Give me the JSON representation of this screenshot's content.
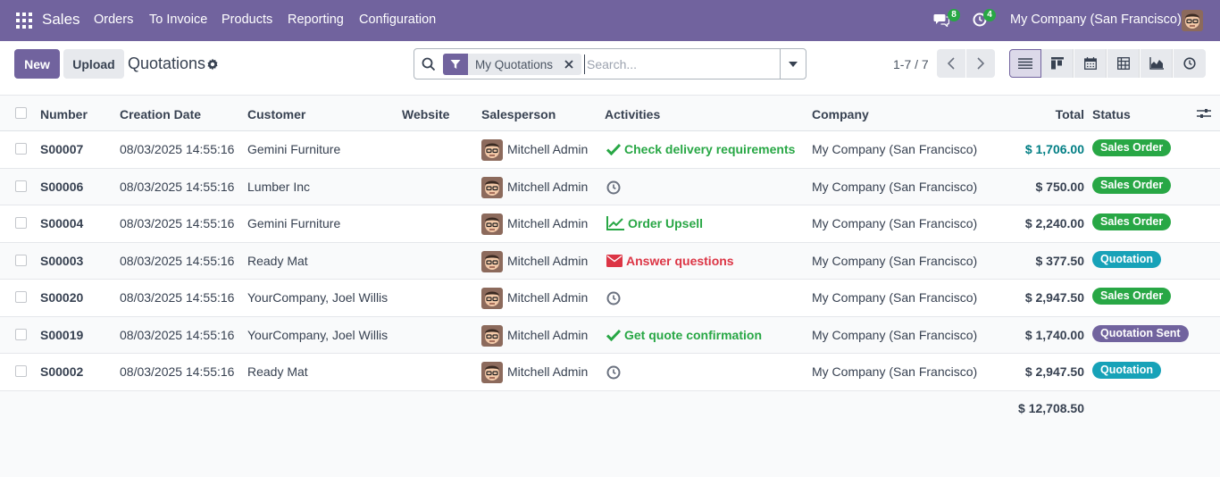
{
  "nav": {
    "brand": "Sales",
    "menu": [
      "Orders",
      "To Invoice",
      "Products",
      "Reporting",
      "Configuration"
    ],
    "messages_count": "8",
    "activities_count": "4",
    "company": "My Company (San Francisco)"
  },
  "control": {
    "new_label": "New",
    "upload_label": "Upload",
    "title": "Quotations",
    "facet_label": "My Quotations",
    "search_placeholder": "Search...",
    "pager": "1-7 / 7"
  },
  "table": {
    "headers": {
      "number": "Number",
      "creation_date": "Creation Date",
      "customer": "Customer",
      "website": "Website",
      "salesperson": "Salesperson",
      "activities": "Activities",
      "company": "Company",
      "total": "Total",
      "status": "Status"
    },
    "rows": [
      {
        "number": "S00007",
        "date": "08/03/2025 14:55:16",
        "customer": "Gemini Furniture",
        "salesperson": "Mitchell Admin",
        "activity_icon": "check-icon",
        "activity": "Check delivery requirements",
        "activity_color": "#28a745",
        "company": "My Company (San Francisco)",
        "total": "$ 1,706.00",
        "total_color": "#017e84",
        "status": "Sales Order",
        "status_color": "#28a745"
      },
      {
        "number": "S00006",
        "date": "08/03/2025 14:55:16",
        "customer": "Lumber Inc",
        "salesperson": "Mitchell Admin",
        "activity_icon": "clock-icon",
        "activity": "",
        "activity_color": "#6b7280",
        "company": "My Company (San Francisco)",
        "total": "$ 750.00",
        "total_color": "#374151",
        "status": "Sales Order",
        "status_color": "#28a745"
      },
      {
        "number": "S00004",
        "date": "08/03/2025 14:55:16",
        "customer": "Gemini Furniture",
        "salesperson": "Mitchell Admin",
        "activity_icon": "trend-icon",
        "activity": "Order Upsell",
        "activity_color": "#28a745",
        "company": "My Company (San Francisco)",
        "total": "$ 2,240.00",
        "total_color": "#374151",
        "status": "Sales Order",
        "status_color": "#28a745"
      },
      {
        "number": "S00003",
        "date": "08/03/2025 14:55:16",
        "customer": "Ready Mat",
        "salesperson": "Mitchell Admin",
        "activity_icon": "envelope-icon",
        "activity": "Answer questions",
        "activity_color": "#dc3545",
        "company": "My Company (San Francisco)",
        "total": "$ 377.50",
        "total_color": "#374151",
        "status": "Quotation",
        "status_color": "#17a2b8"
      },
      {
        "number": "S00020",
        "date": "08/03/2025 14:55:16",
        "customer": "YourCompany, Joel Willis",
        "salesperson": "Mitchell Admin",
        "activity_icon": "clock-icon",
        "activity": "",
        "activity_color": "#6b7280",
        "company": "My Company (San Francisco)",
        "total": "$ 2,947.50",
        "total_color": "#374151",
        "status": "Sales Order",
        "status_color": "#28a745"
      },
      {
        "number": "S00019",
        "date": "08/03/2025 14:55:16",
        "customer": "YourCompany, Joel Willis",
        "salesperson": "Mitchell Admin",
        "activity_icon": "check-icon",
        "activity": "Get quote confirmation",
        "activity_color": "#28a745",
        "company": "My Company (San Francisco)",
        "total": "$ 1,740.00",
        "total_color": "#374151",
        "status": "Quotation Sent",
        "status_color": "#71639e"
      },
      {
        "number": "S00002",
        "date": "08/03/2025 14:55:16",
        "customer": "Ready Mat",
        "salesperson": "Mitchell Admin",
        "activity_icon": "clock-icon",
        "activity": "",
        "activity_color": "#6b7280",
        "company": "My Company (San Francisco)",
        "total": "$ 2,947.50",
        "total_color": "#374151",
        "status": "Quotation",
        "status_color": "#17a2b8"
      }
    ],
    "sum_total": "$ 12,708.50"
  }
}
